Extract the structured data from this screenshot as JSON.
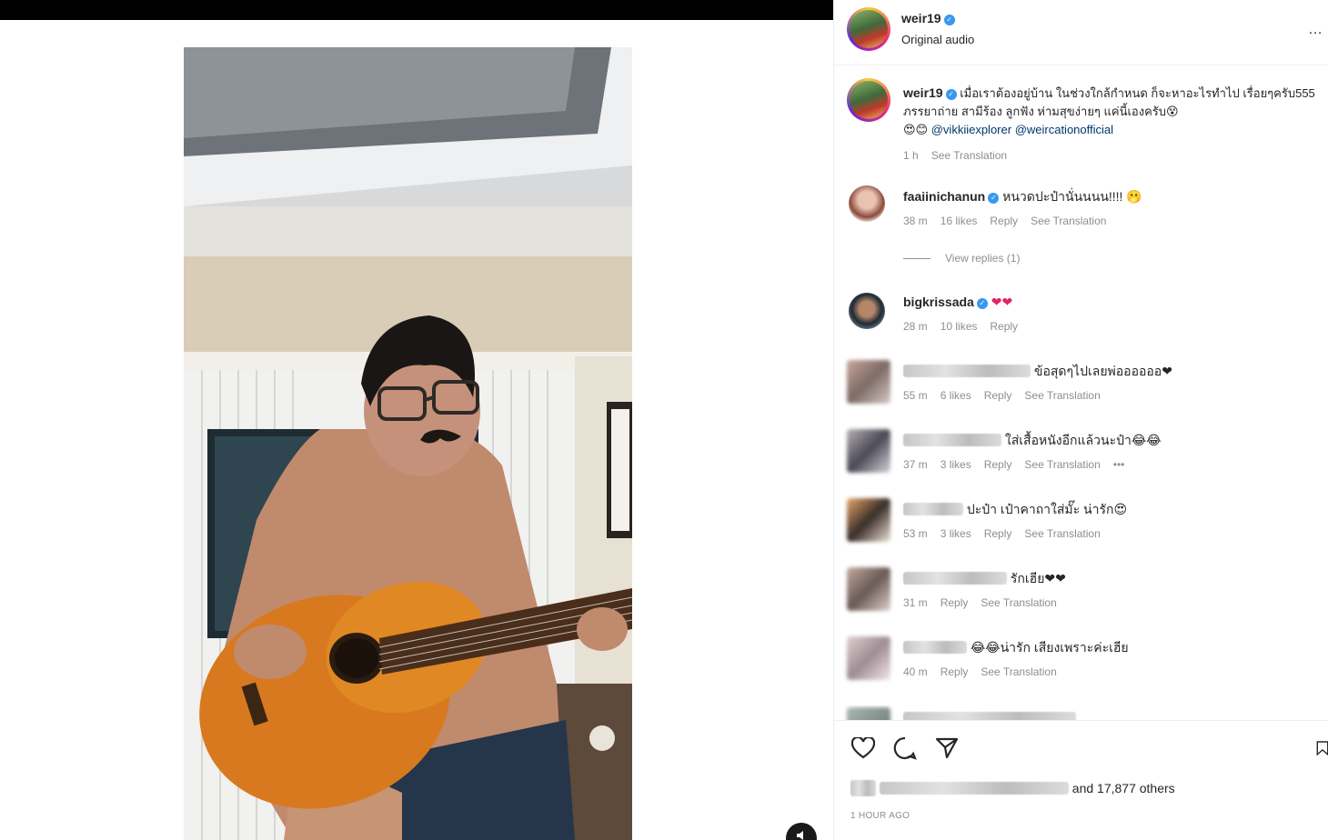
{
  "post": {
    "username": "weir19",
    "audio": "Original audio",
    "caption_user": "weir19",
    "caption_text": "เมื่อเราต้องอยู่บ้าน ในช่วงใกล้กำหนด ก็จะหาอะไรทำไป เรื่อยๆครับ555 ภรรยาถ่าย สามีร้อง ลูกฟัง ห่ามสุขง่ายๆ แค่นี้เองครับ😵",
    "caption_emoji": "😍😊",
    "mention_1": "@vikkiiexplorer",
    "mention_2": "@weircationofficial",
    "caption_time": "1 h",
    "see_translation": "See Translation",
    "more_icon": "…"
  },
  "comments": [
    {
      "user": "faaiinichanun",
      "text": "หนวดปะป๋านั่นนนน!!!! 🫢",
      "time": "38 m",
      "likes": "16 likes",
      "reply": "Reply",
      "translate": "See Translation",
      "view_replies": "View replies (1)"
    },
    {
      "user": "bigkrissada",
      "text": "❤❤",
      "time": "28 m",
      "likes": "10 likes",
      "reply": "Reply"
    },
    {
      "text": "ข้อสุดๆไปเลยพ่ออออออ❤",
      "time": "55 m",
      "likes": "6 likes",
      "reply": "Reply",
      "translate": "See Translation"
    },
    {
      "text": "ใส่เสื้อหนังอีกแล้วนะป๋า😂😂",
      "time": "37 m",
      "likes": "3 likes",
      "reply": "Reply",
      "translate": "See Translation",
      "dots": "•••"
    },
    {
      "text": "ปะป๋า เป๋าคาถาใส่มั๊ะ น่ารัก😍",
      "time": "53 m",
      "likes": "3 likes",
      "reply": "Reply",
      "translate": "See Translation"
    },
    {
      "text": "รักเฮีย❤❤",
      "time": "31 m",
      "reply": "Reply",
      "translate": "See Translation"
    },
    {
      "text": "😂😂น่ารัก เสียงเพราะค่ะเฮีย",
      "time": "40 m",
      "reply": "Reply",
      "translate": "See Translation"
    }
  ],
  "footer": {
    "likes_suffix": "and 17,877 others",
    "posted": "1 HOUR AGO"
  },
  "icons": [
    "heart-icon",
    "comment-icon",
    "share-icon",
    "bookmark-icon",
    "mute-icon",
    "verified-icon"
  ]
}
